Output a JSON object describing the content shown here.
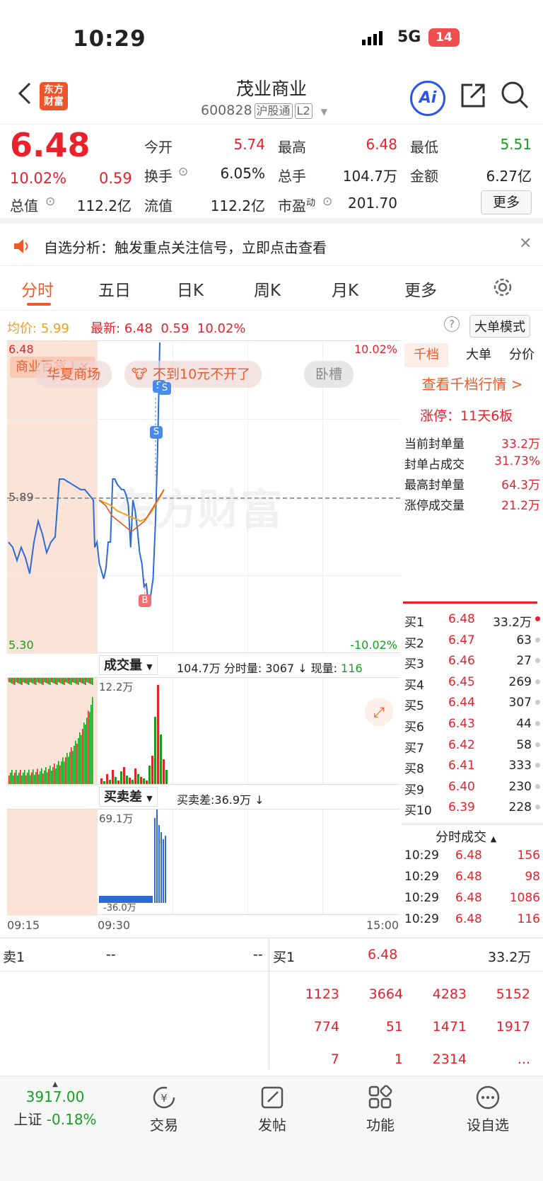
{
  "status_bar": {
    "time": "10:29",
    "network": "5G",
    "battery": "14"
  },
  "nav": {
    "logo_top": "东方",
    "logo_bottom": "财富",
    "title": "茂业商业",
    "code": "600828",
    "tag_hk": "沪股通",
    "tag_level": "L2"
  },
  "quote": {
    "price": "6.48",
    "change_pct": "10.02%",
    "change": "0.59",
    "open_label": "今开",
    "open": "5.74",
    "high_label": "最高",
    "high": "6.48",
    "low_label": "最低",
    "low": "5.51",
    "turnover_label": "换手",
    "turnover": "6.05%",
    "volume_label": "总手",
    "volume": "104.7万",
    "amount_label": "金额",
    "amount": "6.27亿",
    "mcap_label": "总值",
    "mcap": "112.2亿",
    "float_label": "流值",
    "float": "112.2亿",
    "pe_label": "市盈",
    "pe_sup": "动",
    "pe": "201.70",
    "more_label": "更多"
  },
  "alert": {
    "text": "自选分析：触发重点关注信号，立即点击查看"
  },
  "tabs": [
    {
      "label": "分时"
    },
    {
      "label": "五日"
    },
    {
      "label": "日K"
    },
    {
      "label": "周K"
    },
    {
      "label": "月K"
    },
    {
      "label": "更多"
    }
  ],
  "pricebar": {
    "avg_label": "均价:",
    "avg": "5.99",
    "last_label": "最新:",
    "last": "6.48",
    "chg": "0.59",
    "chg_pct": "10.02%",
    "big_order_mode": "大单模式"
  },
  "chart": {
    "top_price": "6.48",
    "mid_price": "5.89",
    "bottom_price": "5.30",
    "top_pct": "10.02%",
    "bottom_pct": "-10.02%",
    "watermark": "东方财富",
    "tags": {
      "sector": "商业百货 | ✕",
      "t1": "华夏商场",
      "t2": "不到10元不开了",
      "t3": "卧槽"
    },
    "markers": {
      "s1": "S",
      "s2": "S",
      "s3": "S",
      "b": "B"
    },
    "price_series": [
      5.7,
      5.72,
      5.64,
      5.61,
      5.58,
      5.62,
      5.72,
      5.72,
      5.96,
      5.96,
      5.94,
      5.93,
      5.92,
      5.92,
      5.9,
      5.86,
      5.7,
      5.88,
      5.84,
      5.77,
      5.68,
      5.64,
      5.55,
      5.56,
      5.48,
      5.52,
      5.58,
      5.78,
      6.06,
      6.48
    ],
    "avg_series": [
      5.88,
      5.87,
      5.86,
      5.84,
      5.83,
      5.82,
      5.81,
      5.8,
      5.81,
      5.84,
      5.88,
      5.92
    ],
    "vol_label": "成交量",
    "vol_stats": "104.7万 分时量: 3067 ↓ 现量:",
    "vol_now": "116",
    "vol_max": "12.2万",
    "diff_label": "买卖差",
    "diff_stats": "买卖差:36.9万 ↓",
    "diff_max": "69.1万",
    "diff_min": "-36.0万",
    "time_start": "09:15",
    "time_open": "09:30",
    "time_end": "15:00"
  },
  "right": {
    "tabs": [
      "千档",
      "大单",
      "分价"
    ],
    "link": "查看千档行情 >",
    "limit_label": "涨停：",
    "limit": "11天6板",
    "stats": [
      [
        "当前封单量",
        "33.2万"
      ],
      [
        "封单占成交",
        "31.73%"
      ],
      [
        "最高封单量",
        "64.3万"
      ],
      [
        "涨停成交量",
        "21.2万"
      ]
    ],
    "bids": [
      [
        "买1",
        "6.48",
        "33.2万"
      ],
      [
        "买2",
        "6.47",
        "63"
      ],
      [
        "买3",
        "6.46",
        "27"
      ],
      [
        "买4",
        "6.45",
        "269"
      ],
      [
        "买5",
        "6.44",
        "307"
      ],
      [
        "买6",
        "6.43",
        "44"
      ],
      [
        "买7",
        "6.42",
        "58"
      ],
      [
        "买8",
        "6.41",
        "333"
      ],
      [
        "买9",
        "6.40",
        "230"
      ],
      [
        "买10",
        "6.39",
        "228"
      ]
    ],
    "trades_label": "分时成交",
    "trades": [
      [
        "10:29",
        "6.48",
        "156"
      ],
      [
        "10:29",
        "6.48",
        "98"
      ],
      [
        "10:29",
        "6.48",
        "1086"
      ],
      [
        "10:29",
        "6.48",
        "116"
      ]
    ]
  },
  "book": {
    "sell_label": "卖1",
    "sell_price": "--",
    "sell_vol": "--",
    "buy_label": "买1",
    "buy_price": "6.48",
    "buy_vol": "33.2万",
    "rows": [
      [
        "1123",
        "3664",
        "4283",
        "5152"
      ],
      [
        "774",
        "51",
        "1471",
        "1917"
      ],
      [
        "7",
        "1",
        "2314",
        "..."
      ]
    ]
  },
  "tabbar": {
    "index_value": "3917.00",
    "index_name": "上证",
    "index_chg": "-0.18%",
    "items": [
      "交易",
      "发帖",
      "功能",
      "设自选"
    ]
  },
  "colors": {
    "up": "#e8212b",
    "down": "#14a022",
    "price_line": "#2b6cd8",
    "avg_line": "#f0a020",
    "accent": "#f05a2a"
  }
}
